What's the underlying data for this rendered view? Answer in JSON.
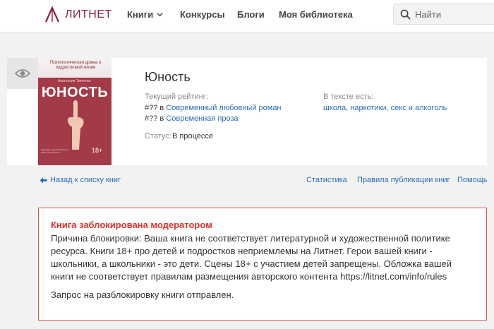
{
  "header": {
    "logo_text": "ЛИТНЕТ",
    "nav": {
      "books": "Книги",
      "contests": "Конкурсы",
      "blogs": "Блоги",
      "library": "Моя библиотека"
    },
    "search_placeholder": "Найти"
  },
  "book": {
    "title": "Юность",
    "cover": {
      "title": "ЮНОСТЬ",
      "tagline": "Психологическая драма о подростковой жизни",
      "author": "Анастасия Ткаченко",
      "age": "18+",
      "blurb": "Однажды подростки взяли и перестали бояться"
    },
    "rating_label": "Текущий рейтинг:",
    "ratings": [
      {
        "prefix": "#?? в",
        "category": "Современный любовный роман"
      },
      {
        "prefix": "#?? в",
        "category": "Современная проза"
      }
    ],
    "status_label": "Статус:",
    "status_value": "В процессе",
    "tags_label": "В тексте есть:",
    "tags_value": "школа, наркотики, секс и алкоголь"
  },
  "links": {
    "back": "Назад к списку книг",
    "stats": "Статистика",
    "rules": "Правила публикации книг",
    "help": "Помощь"
  },
  "alert": {
    "title": "Книга заблокирована модератором",
    "text": "Причина блокировки: Ваша книга не соответствует литературной и художественной политике ресурса. Книги 18+ про детей и подростков неприемлемы на Литнет. Герои вашей книги - школьники, а школьники - это дети. Сцены 18+ с участием детей запрещены. Обложка вашей книги не соответствует правилам размещения авторского контента https://litnet.com/info/rules",
    "request": "Запрос на разблокировку книги отправлен."
  },
  "colors": {
    "brand": "#8c1d49",
    "link": "#2a6db5",
    "alert_border": "#d9534f",
    "alert_title": "#d9342b"
  },
  "icons": [
    "logo-icon",
    "chevron-down-icon",
    "search-icon",
    "eye-icon",
    "arrow-left-icon"
  ]
}
